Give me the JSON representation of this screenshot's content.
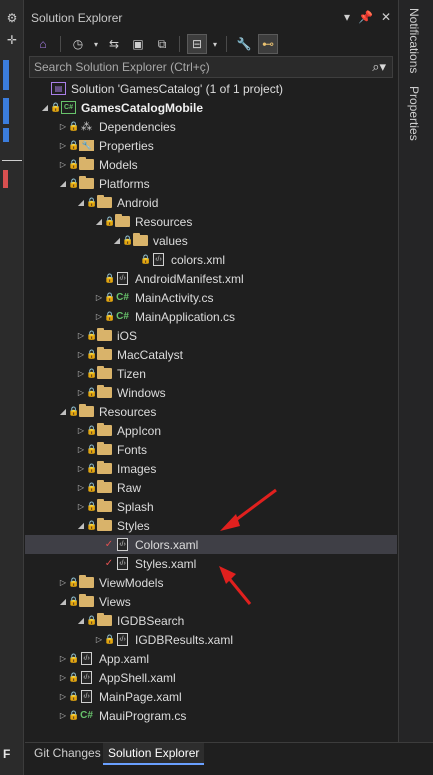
{
  "panel": {
    "title": "Solution Explorer",
    "search_placeholder": "Search Solution Explorer (Ctrl+ç)"
  },
  "tree": [
    {
      "label": "Solution 'GamesCatalog' (1 of 1 project)",
      "icon": "solution-icon",
      "depth": 0,
      "expander": "none",
      "bold": false
    },
    {
      "label": "GamesCatalogMobile",
      "icon": "csharp-project-icon",
      "depth": 0,
      "expander": "expanded",
      "bold": true
    },
    {
      "label": "Dependencies",
      "icon": "dependencies-icon",
      "depth": 1,
      "expander": "collapsed"
    },
    {
      "label": "Properties",
      "icon": "properties-icon",
      "depth": 1,
      "expander": "collapsed"
    },
    {
      "label": "Models",
      "icon": "folder-icon",
      "depth": 1,
      "expander": "collapsed"
    },
    {
      "label": "Platforms",
      "icon": "folder-icon",
      "depth": 1,
      "expander": "expanded"
    },
    {
      "label": "Android",
      "icon": "folder-icon",
      "depth": 2,
      "expander": "expanded"
    },
    {
      "label": "Resources",
      "icon": "folder-icon",
      "depth": 3,
      "expander": "expanded"
    },
    {
      "label": "values",
      "icon": "folder-icon",
      "depth": 4,
      "expander": "expanded"
    },
    {
      "label": "colors.xml",
      "icon": "xml-file-icon",
      "depth": 5,
      "expander": "none"
    },
    {
      "label": "AndroidManifest.xml",
      "icon": "xml-file-icon",
      "depth": 3,
      "expander": "none"
    },
    {
      "label": "MainActivity.cs",
      "icon": "csharp-file-icon",
      "depth": 3,
      "expander": "collapsed"
    },
    {
      "label": "MainApplication.cs",
      "icon": "csharp-file-icon",
      "depth": 3,
      "expander": "collapsed"
    },
    {
      "label": "iOS",
      "icon": "folder-icon",
      "depth": 2,
      "expander": "collapsed"
    },
    {
      "label": "MacCatalyst",
      "icon": "folder-icon",
      "depth": 2,
      "expander": "collapsed"
    },
    {
      "label": "Tizen",
      "icon": "folder-icon",
      "depth": 2,
      "expander": "collapsed"
    },
    {
      "label": "Windows",
      "icon": "folder-icon",
      "depth": 2,
      "expander": "collapsed"
    },
    {
      "label": "Resources",
      "icon": "folder-icon",
      "depth": 1,
      "expander": "expanded"
    },
    {
      "label": "AppIcon",
      "icon": "folder-icon",
      "depth": 2,
      "expander": "collapsed"
    },
    {
      "label": "Fonts",
      "icon": "folder-icon",
      "depth": 2,
      "expander": "collapsed"
    },
    {
      "label": "Images",
      "icon": "folder-icon",
      "depth": 2,
      "expander": "collapsed"
    },
    {
      "label": "Raw",
      "icon": "folder-icon",
      "depth": 2,
      "expander": "collapsed"
    },
    {
      "label": "Splash",
      "icon": "folder-icon",
      "depth": 2,
      "expander": "collapsed"
    },
    {
      "label": "Styles",
      "icon": "folder-icon",
      "depth": 2,
      "expander": "expanded"
    },
    {
      "label": "Colors.xaml",
      "icon": "xaml-file-icon",
      "depth": 3,
      "expander": "none",
      "status": "checkmark",
      "selected": true
    },
    {
      "label": "Styles.xaml",
      "icon": "xaml-file-icon",
      "depth": 3,
      "expander": "none",
      "status": "checkmark"
    },
    {
      "label": "ViewModels",
      "icon": "folder-icon",
      "depth": 1,
      "expander": "collapsed"
    },
    {
      "label": "Views",
      "icon": "folder-icon",
      "depth": 1,
      "expander": "expanded"
    },
    {
      "label": "IGDBSearch",
      "icon": "folder-icon",
      "depth": 2,
      "expander": "expanded"
    },
    {
      "label": "IGDBResults.xaml",
      "icon": "xaml-file-icon",
      "depth": 3,
      "expander": "collapsed"
    },
    {
      "label": "App.xaml",
      "icon": "xaml-file-icon",
      "depth": 1,
      "expander": "collapsed"
    },
    {
      "label": "AppShell.xaml",
      "icon": "xaml-file-icon",
      "depth": 1,
      "expander": "collapsed"
    },
    {
      "label": "MainPage.xaml",
      "icon": "xaml-file-icon",
      "depth": 1,
      "expander": "collapsed"
    },
    {
      "label": "MauiProgram.cs",
      "icon": "csharp-file-icon",
      "depth": 1,
      "expander": "collapsed"
    }
  ],
  "bottom_tabs": [
    "Git Changes",
    "Solution Explorer"
  ],
  "active_bottom_tab": "Solution Explorer",
  "side_tabs": [
    "Notifications",
    "Properties"
  ],
  "left_strip_letter": "F",
  "colors": {
    "accent": "#3b7ddd",
    "folder": "#d9b36a",
    "csharp": "#68c36b",
    "annotation_arrow": "#e0201e"
  }
}
